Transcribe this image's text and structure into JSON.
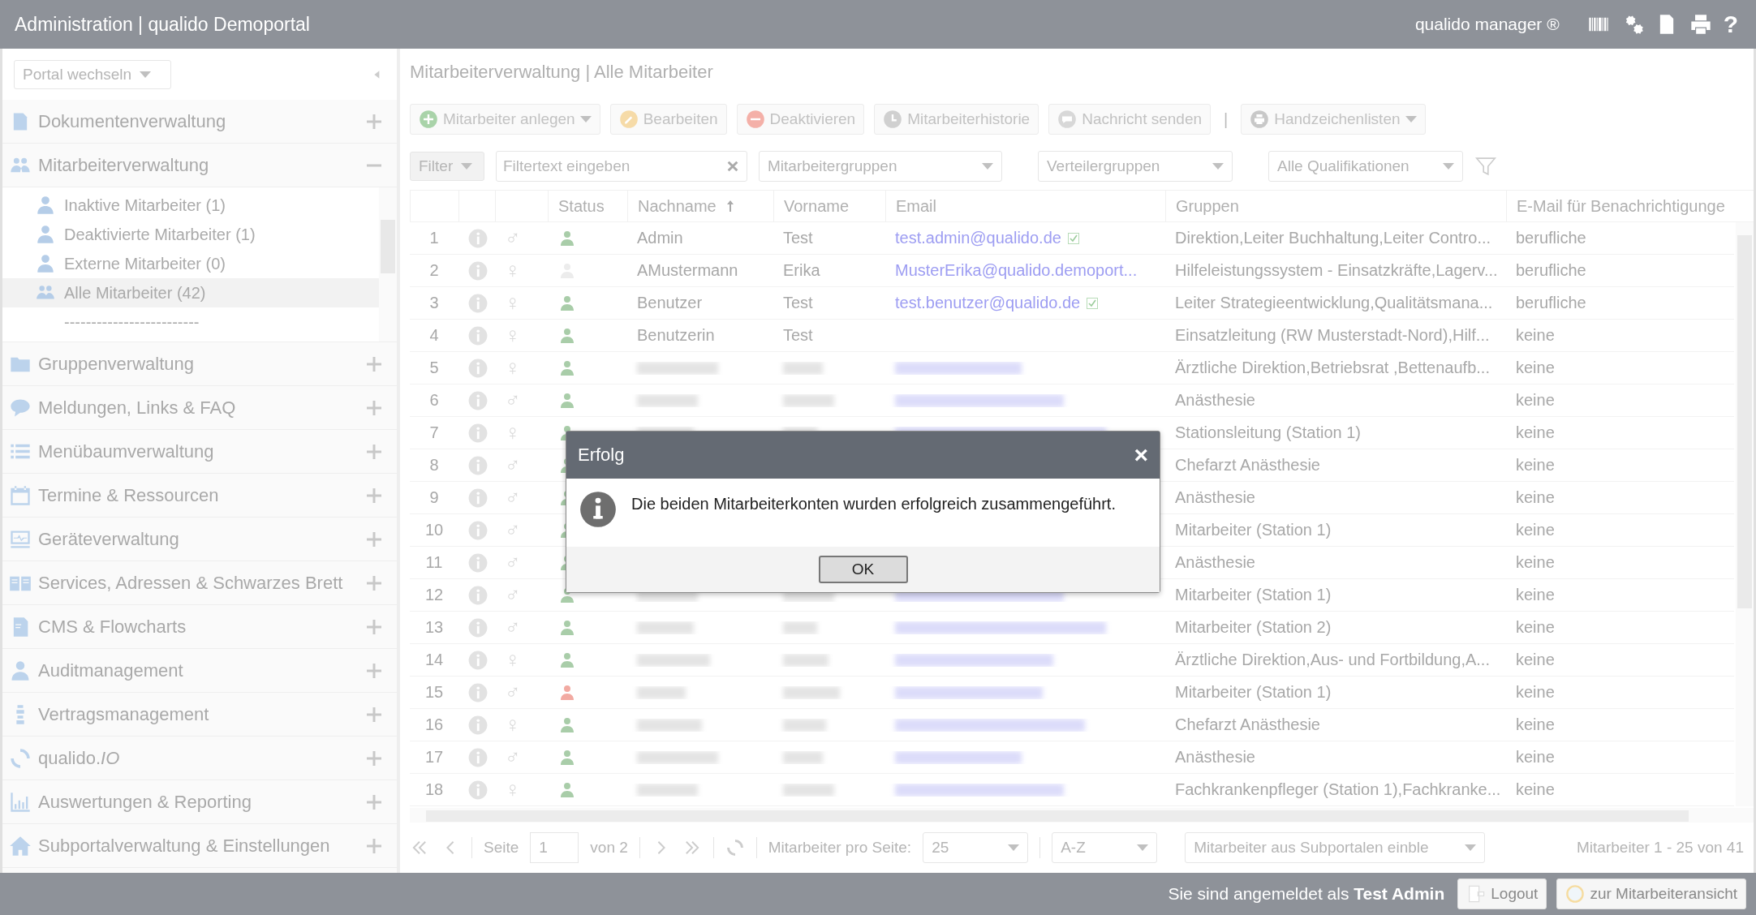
{
  "header": {
    "title": "Administration | qualido Demoportal",
    "product": "qualido manager ®",
    "help": "?"
  },
  "sidebar": {
    "portal_select": "Portal wechseln",
    "sections": [
      {
        "label": "Dokumentenverwaltung",
        "expanded": false
      },
      {
        "label": "Mitarbeiterverwaltung",
        "expanded": true,
        "children": [
          {
            "label": "Inaktive Mitarbeiter (1)",
            "selected": false
          },
          {
            "label": "Deaktivierte Mitarbeiter (1)",
            "selected": false
          },
          {
            "label": "Externe Mitarbeiter (0)",
            "selected": false
          },
          {
            "label": "Alle Mitarbeiter (42)",
            "selected": true
          },
          {
            "label": "-------------------------",
            "selected": false
          }
        ]
      },
      {
        "label": "Gruppenverwaltung",
        "expanded": false
      },
      {
        "label": "Meldungen, Links & FAQ",
        "expanded": false
      },
      {
        "label": "Menübaumverwaltung",
        "expanded": false
      },
      {
        "label": "Termine & Ressourcen",
        "expanded": false
      },
      {
        "label": "Geräteverwaltung",
        "expanded": false
      },
      {
        "label": "Services, Adressen & Schwarzes Brett",
        "expanded": false
      },
      {
        "label": "CMS & Flowcharts",
        "expanded": false
      },
      {
        "label": "Auditmanagement",
        "expanded": false
      },
      {
        "label": "Vertragsmanagement",
        "expanded": false
      },
      {
        "label": "qualido.*IO*",
        "expanded": false
      },
      {
        "label": "Auswertungen & Reporting",
        "expanded": false
      },
      {
        "label": "Subportalverwaltung & Einstellungen",
        "expanded": false
      }
    ]
  },
  "breadcrumb": "Mitarbeiterverwaltung | Alle Mitarbeiter",
  "toolbar": [
    {
      "label": "Mitarbeiter anlegen",
      "dropdown": true
    },
    {
      "label": "Bearbeiten",
      "dropdown": false
    },
    {
      "label": "Deaktivieren",
      "dropdown": false
    },
    {
      "label": "Mitarbeiterhistorie",
      "dropdown": false
    },
    {
      "label": "Nachricht senden",
      "dropdown": false
    },
    {
      "label": "Handzeichenlisten",
      "dropdown": true
    }
  ],
  "toolbar_separator": "|",
  "filters": {
    "filter_button": "Filter",
    "search_placeholder": "Filtertext eingeben",
    "selects": [
      "Mitarbeitergruppen",
      "Verteilergruppen",
      "Alle Qualifikationen"
    ]
  },
  "table": {
    "columns": [
      {
        "label": "Status",
        "sorted": false
      },
      {
        "label": "Nachname",
        "sorted": true
      },
      {
        "label": "Vorname",
        "sorted": false
      },
      {
        "label": "Email",
        "sorted": false
      },
      {
        "label": "Gruppen",
        "sorted": false
      },
      {
        "label": "E-Mail für Benachrichtigunge",
        "sorted": false
      }
    ],
    "rows": [
      {
        "num": "1",
        "gender": "♂",
        "active": true,
        "deactivated": false,
        "redacted": false,
        "nachname": "Admin",
        "vorname": "Test",
        "email": "test.admin@qualido.de",
        "verified": true,
        "gruppen": "Direktion,Leiter Buchhaltung,Leiter Contro...",
        "notify": "berufliche"
      },
      {
        "num": "2",
        "gender": "♀",
        "active": false,
        "deactivated": false,
        "redacted": false,
        "nachname": "AMustermann",
        "vorname": "Erika",
        "email": "MusterErika@qualido.demoport...",
        "verified": false,
        "gruppen": "Hilfeleistungssystem - Einsatzkräfte,Lagerv...",
        "notify": "berufliche"
      },
      {
        "num": "3",
        "gender": "♀",
        "active": true,
        "deactivated": false,
        "redacted": false,
        "nachname": "Benutzer",
        "vorname": "Test",
        "email": "test.benutzer@qualido.de",
        "verified": true,
        "gruppen": "Leiter Strategieentwicklung,Qualitätsmana...",
        "notify": "berufliche"
      },
      {
        "num": "4",
        "gender": "♀",
        "active": true,
        "deactivated": false,
        "redacted": false,
        "nachname": "Benutzerin",
        "vorname": "Test",
        "gruppen": "Einsatzleitung (RW Musterstadt-Nord),Hilf...",
        "notify": "keine"
      },
      {
        "num": "5",
        "gender": "♀",
        "active": true,
        "deactivated": false,
        "redacted": true,
        "gruppen": "Ärztliche Direktion,Betriebsrat ,Bettenaufb...",
        "notify": "keine"
      },
      {
        "num": "6",
        "gender": "♂",
        "active": true,
        "deactivated": false,
        "redacted": true,
        "gruppen": "Anästhesie",
        "notify": "keine"
      },
      {
        "num": "7",
        "gender": "♀",
        "active": true,
        "deactivated": false,
        "redacted": true,
        "gruppen": "Stationsleitung (Station 1)",
        "notify": "keine"
      },
      {
        "num": "8",
        "gender": "♂",
        "active": true,
        "deactivated": false,
        "gruppen": "Chefarzt Anästhesie",
        "notify": "keine"
      },
      {
        "num": "9",
        "gender": "♂",
        "active": true,
        "deactivated": false,
        "gruppen": "Anästhesie",
        "notify": "keine"
      },
      {
        "num": "10",
        "gender": "♂",
        "active": true,
        "deactivated": false,
        "gruppen": "Mitarbeiter (Station 1)",
        "notify": "keine"
      },
      {
        "num": "11",
        "gender": "♂",
        "active": true,
        "deactivated": false,
        "gruppen": "Anästhesie",
        "notify": "keine"
      },
      {
        "num": "12",
        "gender": "♂",
        "active": true,
        "deactivated": false,
        "redacted": true,
        "gruppen": "Mitarbeiter (Station 1)",
        "notify": "keine"
      },
      {
        "num": "13",
        "gender": "♂",
        "active": true,
        "deactivated": false,
        "redacted": true,
        "gruppen": "Mitarbeiter (Station 2)",
        "notify": "keine"
      },
      {
        "num": "14",
        "gender": "♀",
        "active": true,
        "deactivated": false,
        "redacted": true,
        "gruppen": "Ärztliche Direktion,Aus- und Fortbildung,A...",
        "notify": "keine"
      },
      {
        "num": "15",
        "gender": "♂",
        "deactivated": true,
        "redacted": true,
        "gruppen": "Mitarbeiter (Station 1)",
        "notify": "keine"
      },
      {
        "num": "16",
        "gender": "♀",
        "active": true,
        "deactivated": false,
        "redacted": true,
        "gruppen": "Chefarzt Anästhesie",
        "notify": "keine"
      },
      {
        "num": "17",
        "gender": "♂",
        "active": true,
        "deactivated": false,
        "redacted": true,
        "gruppen": "Anästhesie",
        "notify": "keine"
      },
      {
        "num": "18",
        "gender": "♀",
        "active": true,
        "deactivated": false,
        "redacted": true,
        "gruppen": "Fachkrankenpfleger (Station 1),Fachkranke...",
        "notify": "keine"
      }
    ]
  },
  "pager": {
    "page_label": "Seite",
    "page": "1",
    "of": "von 2",
    "per_page_label": "Mitarbeiter pro Seite:",
    "per_page": "25",
    "sort": "A-Z",
    "subportal_select": "Mitarbeiter aus Subportalen einble",
    "summary": "Mitarbeiter 1 - 25 von 41"
  },
  "status_bar": {
    "login_text": "Sie sind angemeldet als **Test Admin**",
    "buttons": [
      "Logout",
      "zur Mitarbeiteransicht"
    ]
  },
  "dialog": {
    "title": "Erfolg",
    "close": "×",
    "message": "Die beiden Mitarbeiterkonten wurden erfolgreich zusammengeführt.",
    "button": "OK"
  }
}
